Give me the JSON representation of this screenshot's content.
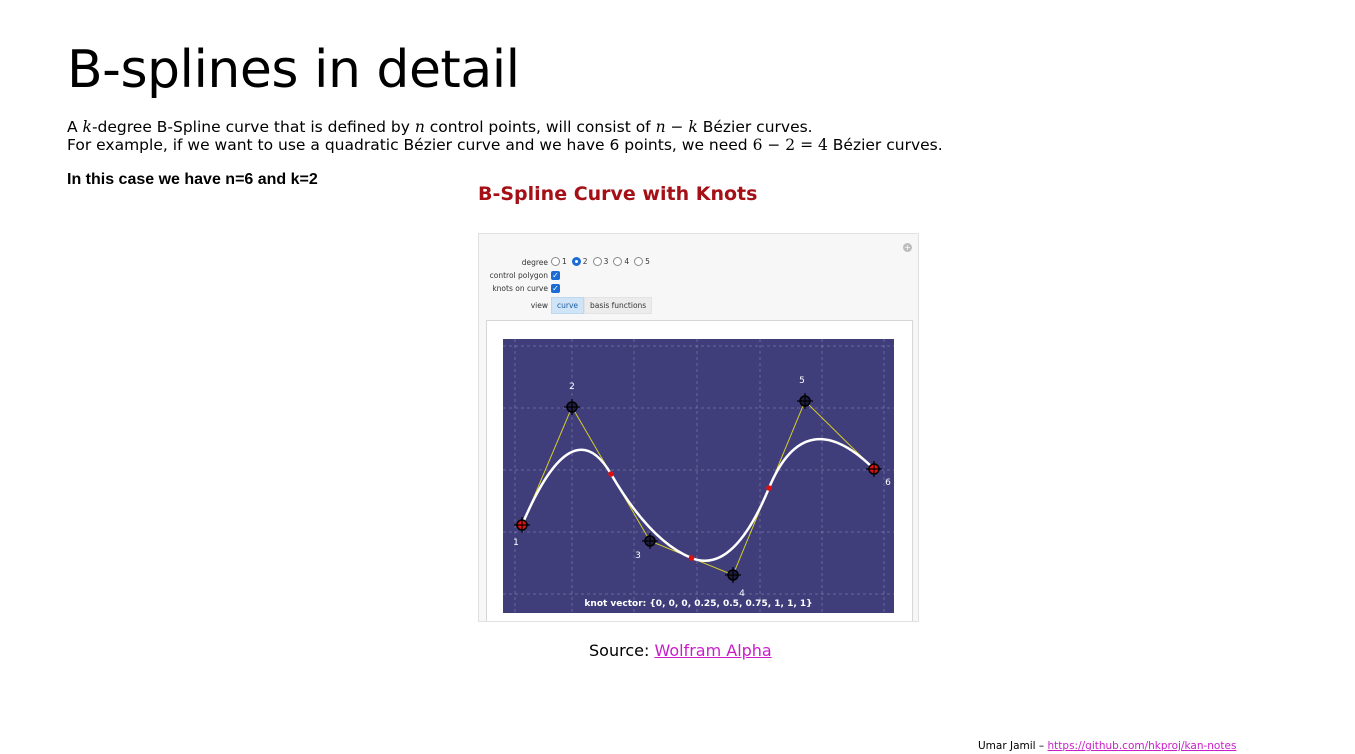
{
  "slide": {
    "title": "B-splines in detail",
    "intro_line1": {
      "t1": "A ",
      "k": "k",
      "t2": "-degree B-Spline curve that is defined by ",
      "n": "n",
      "t3": " control points, will consist of ",
      "expr": "n − k",
      "t4": " Bézier curves."
    },
    "intro_line2": {
      "t1": "For example, if we want to use a quadratic Bézier curve and we have 6 points, we need ",
      "expr": "6 − 2 = 4",
      "t2": " Bézier curves."
    },
    "case_note": "In this case we have n=6 and k=2",
    "source_label": "Source: ",
    "source_link": "Wolfram Alpha",
    "footer_author": "Umar Jamil – ",
    "footer_link": "https://github.com/hkproj/kan-notes"
  },
  "widget": {
    "title": "B-Spline Curve with Knots",
    "plus_icon": "+",
    "degree_label": "degree",
    "degree_options": [
      "1",
      "2",
      "3",
      "4",
      "5"
    ],
    "degree_selected": "2",
    "control_polygon_label": "control polygon",
    "control_polygon_checked": true,
    "knots_on_curve_label": "knots on curve",
    "knots_on_curve_checked": true,
    "check_glyph": "✓",
    "view_label": "view",
    "view_tabs": [
      "curve",
      "basis functions"
    ],
    "view_selected": "curve",
    "knot_vector_text": "knot vector: {0, 0, 0, 0.25, 0.5, 0.75, 1, 1, 1}",
    "colors": {
      "plot_background": "#3f3d7a",
      "curve": "#ffffff",
      "control_polygon": "#d4cc2a",
      "knot_points": "#e01010",
      "title": "#a50f16"
    },
    "control_points": [
      {
        "label": "1"
      },
      {
        "label": "2"
      },
      {
        "label": "3"
      },
      {
        "label": "4"
      },
      {
        "label": "5"
      },
      {
        "label": "6"
      }
    ]
  }
}
